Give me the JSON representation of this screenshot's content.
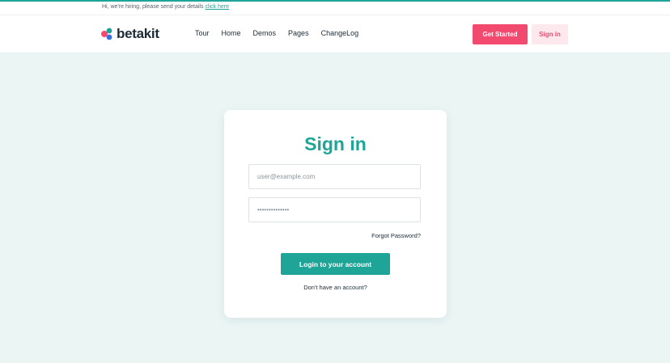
{
  "announcement": {
    "text": "Hi, we're hiring, please send your details",
    "link_label": "click here"
  },
  "header": {
    "brand": "betakit",
    "nav": [
      "Tour",
      "Home",
      "Demos",
      "Pages",
      "ChangeLog"
    ],
    "get_started_label": "Get Started",
    "sign_in_label": "Sign in"
  },
  "login": {
    "title": "Sign in",
    "email_placeholder": "user@example.com",
    "password_value": "••••••••••••••",
    "forgot_label": "Forgot Password?",
    "submit_label": "Login to your account",
    "no_account_label": "Don't have an account?"
  },
  "colors": {
    "accent": "#1fa597",
    "brand_pink": "#f2496f",
    "background": "#eaf5f4"
  },
  "icons": {
    "logo": "betakit-logo-icon"
  }
}
